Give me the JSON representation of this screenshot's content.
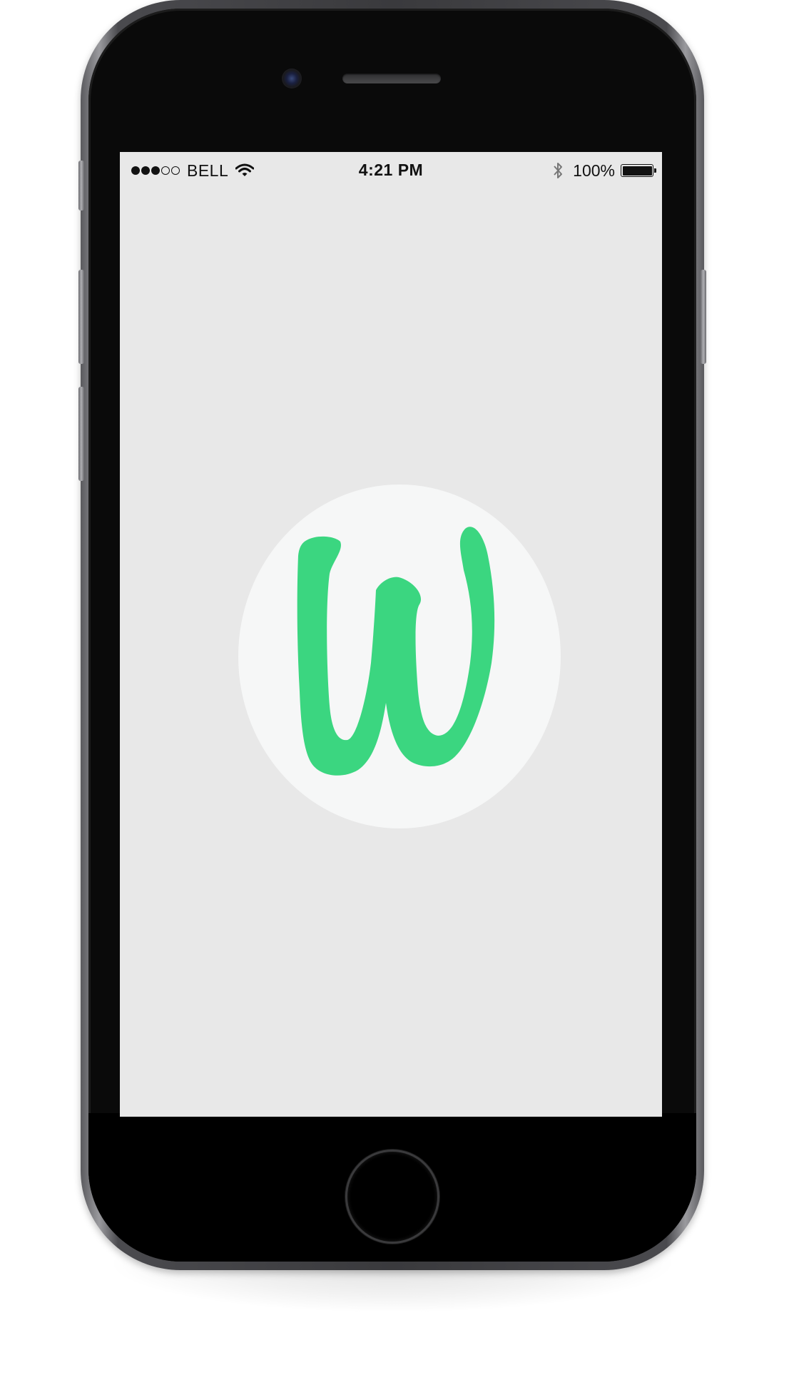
{
  "status_bar": {
    "carrier": "BELL",
    "signal_bars_filled": 3,
    "signal_bars_total": 5,
    "time": "4:21 PM",
    "battery_percent": "100%",
    "battery_level": 1.0
  },
  "app": {
    "logo_icon": "w-letter-logo-icon",
    "accent_color": "#3bd680",
    "logo_background": "#f6f7f7",
    "screen_background": "#e8e8e8"
  },
  "icons": {
    "wifi": "wifi-icon",
    "bluetooth": "bluetooth-icon",
    "battery": "battery-icon",
    "camera": "camera-icon",
    "home": "home-button-icon"
  }
}
